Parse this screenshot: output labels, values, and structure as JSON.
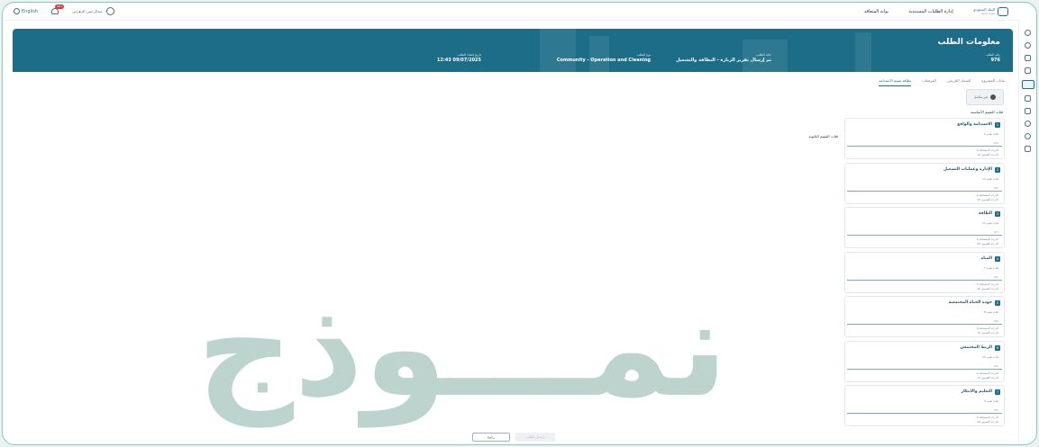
{
  "topbar": {
    "language": "English",
    "notification_badge": "99+",
    "user_name": "عبدالرحمن الزهراني",
    "nav": [
      "بوابة المتعاقد",
      "إدارة الطلبات المستندية"
    ],
    "brand_name": "البنك السعودي",
    "brand_sub": "لتمويل الأعمال"
  },
  "hero": {
    "title": "معلومات الطلب",
    "fields": [
      {
        "label": "رقم الطلب",
        "value": "976"
      },
      {
        "label": "حالة الطلب",
        "value": "تم إرسال تقرير الزيارة - النظافة والتشغيل"
      },
      {
        "label": "نوع الطلب",
        "value": "Community - Operation and Cleaning"
      },
      {
        "label": "تاريخ إنشاء الطلب",
        "value": "12:43 09/07/2025"
      }
    ]
  },
  "tabs": [
    "بيانات المشروع",
    "السجل التاريخي",
    "المرفقات",
    "بطاقة تقييم الاستدامة"
  ],
  "status_chip": "غير مكتمل",
  "sections": {
    "main_criteria": "فئات التقييم الأساسية",
    "sub_criteria": "فئات التقييم الثانوية"
  },
  "criteria": [
    {
      "num": "1",
      "title": "الاستدامة والواقع",
      "count": "9 فئات تقييم",
      "pct": "0%",
      "progress": 0,
      "line1": "الدرجة المستحقة 0",
      "line2": "الدرجة القصوى 18"
    },
    {
      "num": "2",
      "title": "الإدارة وعمليات التشغيل",
      "count": "10 فئات تقييم",
      "pct": "0%",
      "progress": 0,
      "line1": "الدرجة المستحقة 0",
      "line2": "الدرجة القصوى 23"
    },
    {
      "num": "3",
      "title": "الطاقة",
      "count": "10 فئات تقييم",
      "pct": "0%",
      "progress": 0,
      "line1": "الدرجة المستحقة 0",
      "line2": "الدرجة القصوى 20"
    },
    {
      "num": "4",
      "title": "المياه",
      "count": "7 فئات تقييم",
      "pct": "0%",
      "progress": 0,
      "line1": "الدرجة المستحقة 0",
      "line2": "الدرجة القصوى 20"
    },
    {
      "num": "5",
      "title": "جودة الحياة المجتمعية",
      "count": "8 فئات تقييم",
      "pct": "0%",
      "progress": 0,
      "line1": "الدرجة المستحقة 0",
      "line2": "الدرجة القصوى 15"
    },
    {
      "num": "6",
      "title": "الربط المجتمعي",
      "count": "10 فئات تقييم",
      "pct": "0%",
      "progress": 0,
      "line1": "الدرجة المستحقة 0",
      "line2": "الدرجة القصوى 12"
    },
    {
      "num": "7",
      "title": "التعليم والابتكار",
      "count": "4 فئات تقييم",
      "pct": "0%",
      "progress": 0,
      "line1": "الدرجة المستحقة 0",
      "line2": "الدرجة القصوى 10"
    }
  ],
  "watermark": "نمـــوذج",
  "footer": {
    "back": "رجوع",
    "submit": "إرسال الطلب"
  }
}
